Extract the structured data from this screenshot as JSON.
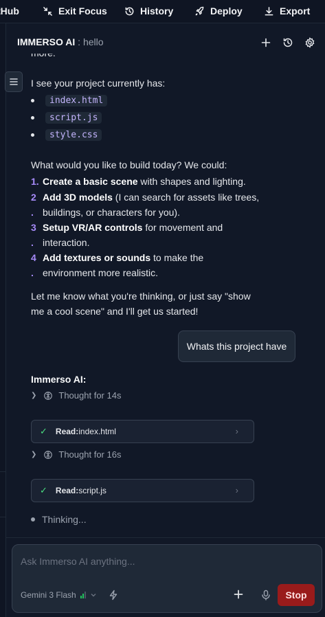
{
  "topbar": {
    "github_label": "tHub",
    "exit_focus_label": "Exit Focus",
    "history_label": "History",
    "deploy_label": "Deploy",
    "export_label": "Export"
  },
  "header": {
    "brand": "IMMERSO AI",
    "separator": " : ",
    "chat_name": "hello"
  },
  "messages": {
    "cut_text": "more.",
    "intro": "I see your project currently has:",
    "files": [
      "index.html",
      "script.js",
      "style.css"
    ],
    "question": "What would you like to build today? We could:",
    "options": [
      {
        "num": "1.",
        "bold": "Create a basic scene",
        "line1": " with shapes and lighting.",
        "line2": ""
      },
      {
        "num": "2",
        "num2": ".",
        "bold": "Add 3D models",
        "line1": " (I can search for assets like trees,",
        "line2": "buildings, or characters for you)."
      },
      {
        "num": "3",
        "num2": ".",
        "bold": "Setup VR/AR controls",
        "line1": " for movement and",
        "line2": "interaction."
      },
      {
        "num": "4",
        "num2": ".",
        "bold": "Add textures or sounds",
        "line1": " to make the",
        "line2": "environment more realistic."
      }
    ],
    "closing_line1": "Let me know what you're thinking, or just say \"show",
    "closing_line2": "me a cool scene\" and I'll get us started!",
    "user_message": "Whats this project have",
    "ai_label": "Immerso AI:",
    "thought1": "Thought for 14s",
    "tool1_action": "Read",
    "tool1_sep": " : ",
    "tool1_target": "index.html",
    "thought2": "Thought for 16s",
    "tool2_action": "Read",
    "tool2_sep": " : ",
    "tool2_target": "script.js",
    "thinking": "Thinking..."
  },
  "composer": {
    "placeholder": "Ask Immerso AI anything...",
    "model": "Gemini 3 Flash",
    "stop_label": "Stop"
  },
  "colors": {
    "background": "#111827",
    "accent_purple": "#a78bfa",
    "code_text": "#c4b5fd",
    "success_green": "#4ade80",
    "stop_red": "#991b1b"
  }
}
